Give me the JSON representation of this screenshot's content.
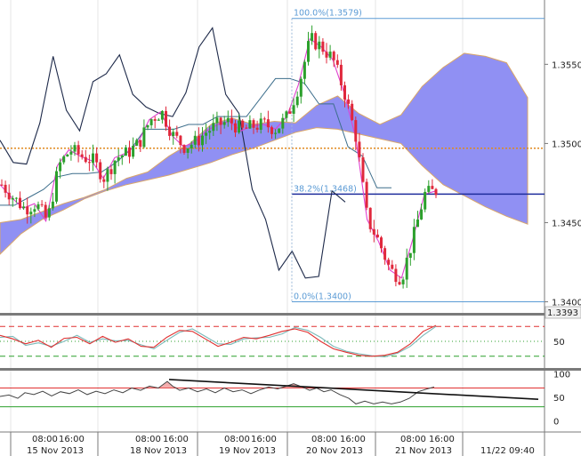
{
  "colors": {
    "background": "#ffffff",
    "grid": "#e4e4e4",
    "separator": "#7a7a7a",
    "candle_up": "#2ca02c",
    "candle_down": "#e0283c",
    "cloud_bullish": "#8a8af2",
    "cloud_bearish": "#8a8af2",
    "cloud_edge": "#d9a66a",
    "tenkan": "#e040d0",
    "kijun": "#3d6e8c",
    "chikou": "#1e2a4a",
    "fib_line": "#5b9bd5",
    "horizontal_level": "#1f2d9c",
    "dotted_level": "#e08a1e",
    "stoch_main": "#e03030",
    "stoch_signal": "#7ab8b8",
    "osc_black": "#111111",
    "osc_red_level": "#e03030",
    "osc_green_level": "#2ca02c",
    "price_badge_bg": "#f0f0f0"
  },
  "price_panel": {
    "ylim": [
      1.3393,
      1.3585
    ],
    "tick_labels": [
      "1.3550",
      "1.3500",
      "1.3450",
      "1.3400"
    ],
    "last_price_label": "1.3393",
    "horizontal_level": 1.3468,
    "dotted_level": 1.3497,
    "fib_levels": [
      {
        "label": "100.0%(1.3579)",
        "price": 1.3579
      },
      {
        "label": "38.2%(1.3468)",
        "price": 1.3468
      },
      {
        "label": "0.0%(1.3400)",
        "price": 1.34
      }
    ]
  },
  "stoch_panel": {
    "ylim": [
      0,
      100
    ],
    "tick_labels": [
      "50"
    ],
    "levels": [
      80,
      50,
      20
    ]
  },
  "osc_panel": {
    "ylim": [
      -20,
      105
    ],
    "tick_labels": [
      "100",
      "50",
      "0"
    ],
    "levels": {
      "red": 70,
      "green": 30
    }
  },
  "x_axis": {
    "time_labels": [
      "08:00",
      "16:00",
      "08:00",
      "16:00",
      "08:00",
      "16:00",
      "08:00",
      "16:00",
      "08:00",
      "16:00"
    ],
    "date_labels": [
      "15 Nov 2013",
      "18 Nov 2013",
      "19 Nov 2013",
      "20 Nov 2013",
      "21 Nov 2013"
    ],
    "current_time": "11/22 09:40"
  },
  "chart_data": {
    "type": "line",
    "title": "",
    "xlabel": "",
    "ylabel": "",
    "ylim": [
      1.3393,
      1.3585
    ],
    "series": [
      {
        "values": [
          1.3474,
          1.3466,
          1.3459,
          1.3462,
          1.3451,
          1.3486,
          1.3496,
          1.3492,
          1.3489,
          1.3478,
          1.3491,
          1.3494,
          1.35,
          1.3515,
          1.352,
          1.3505,
          1.3498,
          1.3501,
          1.3508,
          1.3512,
          1.3514,
          1.3508,
          1.3511,
          1.3512,
          1.3509,
          1.3517,
          1.3537,
          1.3566,
          1.3561,
          1.3553,
          1.3532,
          1.3504,
          1.3452,
          1.3438,
          1.342,
          1.3415,
          1.344,
          1.3468,
          1.347
        ]
      },
      {
        "values": [
          1.3461,
          1.3461,
          1.3466,
          1.3471,
          1.3479,
          1.3481,
          1.3481,
          1.3482,
          1.3488,
          1.3496,
          1.3509,
          1.3509,
          1.3509,
          1.3512,
          1.3512,
          1.3517,
          1.3517,
          1.3517,
          1.3529,
          1.3541,
          1.3541,
          1.3538,
          1.3525,
          1.3525,
          1.3498,
          1.3492,
          1.3472,
          1.3472
        ]
      },
      {
        "values": [
          1.3502,
          1.3488,
          1.3487,
          1.3513,
          1.3555,
          1.3521,
          1.3508,
          1.3539,
          1.3544,
          1.3556,
          1.3531,
          1.3523,
          1.3519,
          1.3517,
          1.3532,
          1.3561,
          1.3573,
          1.3531,
          1.3519,
          1.3471,
          1.3452,
          1.342,
          1.3432,
          1.3415,
          1.3416,
          1.347,
          1.3463
        ]
      },
      {
        "values": [
          1.345,
          1.3452,
          1.3457,
          1.3462,
          1.3466,
          1.3471,
          1.3474,
          1.3477,
          1.348,
          1.3484,
          1.3488,
          1.3493,
          1.3497,
          1.3502,
          1.3507,
          1.351,
          1.3509,
          1.3506,
          1.3503,
          1.35,
          1.3486,
          1.3474,
          1.3467,
          1.346,
          1.3454,
          1.3449
        ]
      },
      {
        "values": [
          1.343,
          1.3443,
          1.3452,
          1.3458,
          1.3465,
          1.347,
          1.3478,
          1.3482,
          1.3492,
          1.35,
          1.3512,
          1.3516,
          1.3512,
          1.3514,
          1.3513,
          1.3524,
          1.353,
          1.3519,
          1.3512,
          1.3518,
          1.3536,
          1.3548,
          1.3557,
          1.3555,
          1.3551,
          1.3529,
          1.3502,
          1.3488,
          1.3481,
          1.3472,
          1.3459,
          1.3452
        ]
      }
    ],
    "stoch": {
      "main": [
        62,
        55,
        45,
        52,
        38,
        56,
        58,
        45,
        60,
        48,
        55,
        40,
        38,
        58,
        72,
        70,
        55,
        40,
        48,
        58,
        55,
        62,
        70,
        75,
        68,
        50,
        35,
        28,
        22,
        20,
        22,
        28,
        45,
        70,
        82
      ],
      "signal": [
        58,
        60,
        42,
        47,
        40,
        50,
        62,
        48,
        55,
        51,
        52,
        43,
        35,
        52,
        68,
        75,
        60,
        45,
        44,
        55,
        57,
        58,
        65,
        78,
        72,
        58,
        40,
        30,
        25,
        21,
        19,
        26,
        40,
        62,
        80
      ]
    },
    "oscillator": [
      [
        0,
        52
      ],
      [
        10,
        55
      ],
      [
        20,
        48
      ],
      [
        28,
        60
      ],
      [
        38,
        56
      ],
      [
        48,
        63
      ],
      [
        58,
        53
      ],
      [
        68,
        62
      ],
      [
        78,
        58
      ],
      [
        88,
        66
      ],
      [
        98,
        56
      ],
      [
        108,
        63
      ],
      [
        118,
        58
      ],
      [
        128,
        66
      ],
      [
        138,
        60
      ],
      [
        148,
        70
      ],
      [
        158,
        65
      ],
      [
        168,
        74
      ],
      [
        178,
        70
      ],
      [
        188,
        84
      ],
      [
        194,
        74
      ],
      [
        202,
        65
      ],
      [
        212,
        70
      ],
      [
        222,
        62
      ],
      [
        232,
        68
      ],
      [
        242,
        60
      ],
      [
        252,
        70
      ],
      [
        262,
        62
      ],
      [
        272,
        66
      ],
      [
        282,
        58
      ],
      [
        292,
        66
      ],
      [
        302,
        72
      ],
      [
        312,
        68
      ],
      [
        322,
        74
      ],
      [
        330,
        79
      ],
      [
        340,
        72
      ],
      [
        348,
        65
      ],
      [
        356,
        70
      ],
      [
        364,
        62
      ],
      [
        372,
        66
      ],
      [
        382,
        56
      ],
      [
        392,
        48
      ],
      [
        400,
        36
      ],
      [
        410,
        42
      ],
      [
        420,
        36
      ],
      [
        430,
        40
      ],
      [
        440,
        36
      ],
      [
        450,
        40
      ],
      [
        460,
        48
      ],
      [
        470,
        62
      ],
      [
        480,
        68
      ],
      [
        488,
        72
      ]
    ],
    "trendline": [
      [
        190,
        88
      ],
      [
        605,
        46
      ]
    ]
  }
}
